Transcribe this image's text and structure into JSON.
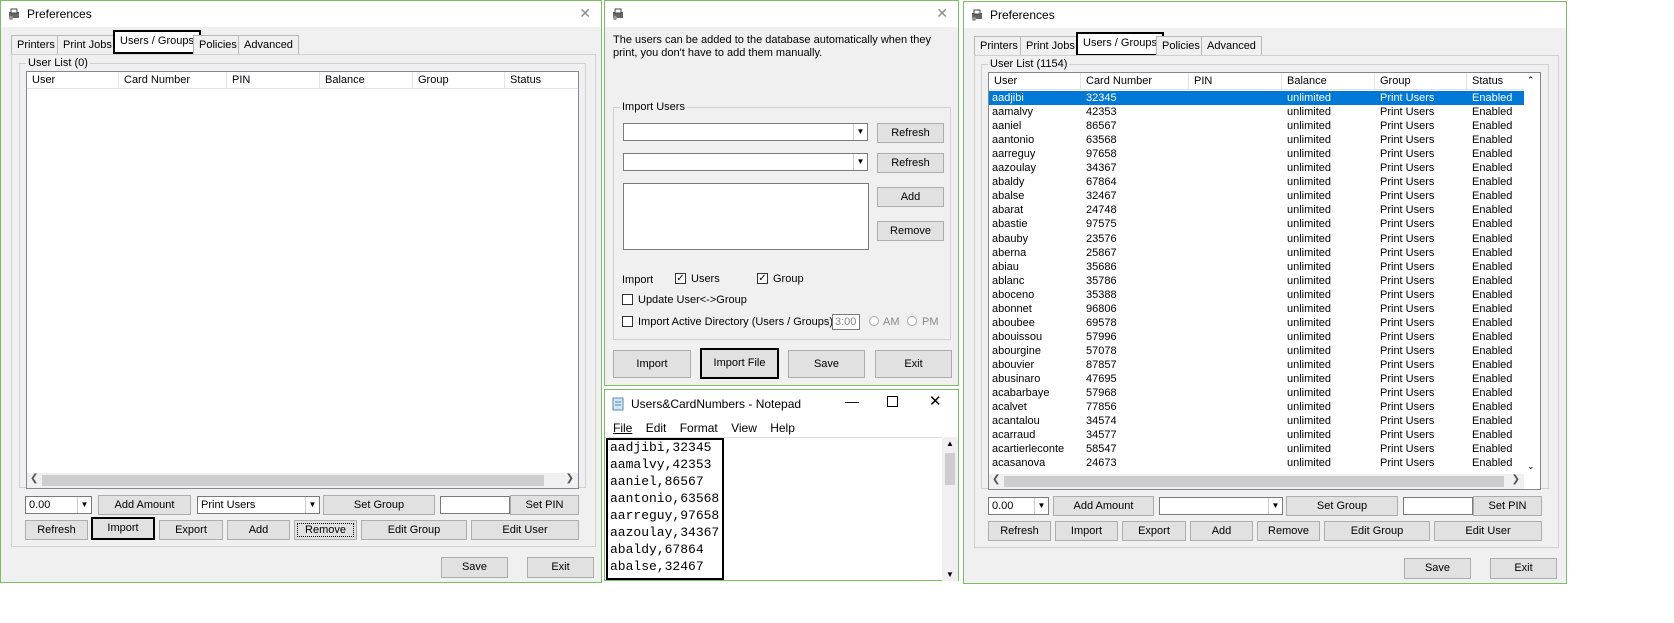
{
  "left": {
    "title": "Preferences",
    "tabs": [
      "Printers",
      "Print Jobs",
      "Users / Groups",
      "Policies",
      "Advanced"
    ],
    "group_label": "User List (0)",
    "columns": [
      "User",
      "Card Number",
      "PIN",
      "Balance",
      "Group",
      "Status"
    ],
    "amount_value": "0.00",
    "group_select_value": "Print Users",
    "buttons": {
      "add_amount": "Add Amount",
      "set_group": "Set Group",
      "set_pin": "Set PIN",
      "refresh": "Refresh",
      "import": "Import",
      "export": "Export",
      "add": "Add",
      "remove": "Remove",
      "edit_group": "Edit Group",
      "edit_user": "Edit User",
      "save": "Save",
      "exit": "Exit"
    }
  },
  "middle": {
    "description": "The users can be added to the database automatically when they print, you don't have to add them manually.",
    "group_label": "Import Users",
    "refresh1": "Refresh",
    "refresh2": "Refresh",
    "add": "Add",
    "remove": "Remove",
    "import_label": "Import",
    "users_check": "Users",
    "group_check": "Group",
    "update_label": "Update User<->Group",
    "ad_label": "Import Active Directory (Users / Groups)",
    "time_value": "3:00",
    "am": "AM",
    "pm": "PM",
    "import_btn": "Import",
    "import_file_btn": "Import File",
    "save_btn": "Save",
    "exit_btn": "Exit"
  },
  "notepad": {
    "title": "Users&CardNumbers - Notepad",
    "menu": [
      "File",
      "Edit",
      "Format",
      "View",
      "Help"
    ],
    "lines": [
      "aadjibi,32345",
      "aamalvy,42353",
      "aaniel,86567",
      "aantonio,63568",
      "aarreguy,97658",
      "aazoulay,34367",
      "abaldy,67864",
      "abalse,32467"
    ]
  },
  "right": {
    "title": "Preferences",
    "tabs": [
      "Printers",
      "Print Jobs",
      "Users / Groups",
      "Policies",
      "Advanced"
    ],
    "group_label": "User List (1154)",
    "columns": [
      "User",
      "Card Number",
      "PIN",
      "Balance",
      "Group",
      "Status"
    ],
    "rows": [
      [
        "aadjibi",
        "32345",
        "",
        "unlimited",
        "Print Users",
        "Enabled"
      ],
      [
        "aamalvy",
        "42353",
        "",
        "unlimited",
        "Print Users",
        "Enabled"
      ],
      [
        "aaniel",
        "86567",
        "",
        "unlimited",
        "Print Users",
        "Enabled"
      ],
      [
        "aantonio",
        "63568",
        "",
        "unlimited",
        "Print Users",
        "Enabled"
      ],
      [
        "aarreguy",
        "97658",
        "",
        "unlimited",
        "Print Users",
        "Enabled"
      ],
      [
        "aazoulay",
        "34367",
        "",
        "unlimited",
        "Print Users",
        "Enabled"
      ],
      [
        "abaldy",
        "67864",
        "",
        "unlimited",
        "Print Users",
        "Enabled"
      ],
      [
        "abalse",
        "32467",
        "",
        "unlimited",
        "Print Users",
        "Enabled"
      ],
      [
        "abarat",
        "24748",
        "",
        "unlimited",
        "Print Users",
        "Enabled"
      ],
      [
        "abastie",
        "97575",
        "",
        "unlimited",
        "Print Users",
        "Enabled"
      ],
      [
        "abauby",
        "23576",
        "",
        "unlimited",
        "Print Users",
        "Enabled"
      ],
      [
        "aberna",
        "25867",
        "",
        "unlimited",
        "Print Users",
        "Enabled"
      ],
      [
        "abiau",
        "35686",
        "",
        "unlimited",
        "Print Users",
        "Enabled"
      ],
      [
        "ablanc",
        "35786",
        "",
        "unlimited",
        "Print Users",
        "Enabled"
      ],
      [
        "aboceno",
        "35388",
        "",
        "unlimited",
        "Print Users",
        "Enabled"
      ],
      [
        "abonnet",
        "96806",
        "",
        "unlimited",
        "Print Users",
        "Enabled"
      ],
      [
        "aboubee",
        "69578",
        "",
        "unlimited",
        "Print Users",
        "Enabled"
      ],
      [
        "abouissou",
        "57996",
        "",
        "unlimited",
        "Print Users",
        "Enabled"
      ],
      [
        "abourgine",
        "57078",
        "",
        "unlimited",
        "Print Users",
        "Enabled"
      ],
      [
        "abouvier",
        "87857",
        "",
        "unlimited",
        "Print Users",
        "Enabled"
      ],
      [
        "abusinaro",
        "47695",
        "",
        "unlimited",
        "Print Users",
        "Enabled"
      ],
      [
        "acabarbaye",
        "57968",
        "",
        "unlimited",
        "Print Users",
        "Enabled"
      ],
      [
        "acalvet",
        "77856",
        "",
        "unlimited",
        "Print Users",
        "Enabled"
      ],
      [
        "acantalou",
        "34574",
        "",
        "unlimited",
        "Print Users",
        "Enabled"
      ],
      [
        "acarraud",
        "34577",
        "",
        "unlimited",
        "Print Users",
        "Enabled"
      ],
      [
        "acartierleconte",
        "58547",
        "",
        "unlimited",
        "Print Users",
        "Enabled"
      ],
      [
        "acasanova",
        "24673",
        "",
        "unlimited",
        "Print Users",
        "Enabled"
      ]
    ],
    "amount_value": "0.00",
    "buttons": {
      "add_amount": "Add Amount",
      "set_group": "Set Group",
      "set_pin": "Set PIN",
      "refresh": "Refresh",
      "import": "Import",
      "export": "Export",
      "add": "Add",
      "remove": "Remove",
      "edit_group": "Edit Group",
      "edit_user": "Edit User",
      "save": "Save",
      "exit": "Exit"
    }
  },
  "colors": {
    "selection": "#0078d7",
    "window_border": "#7cbf62"
  }
}
